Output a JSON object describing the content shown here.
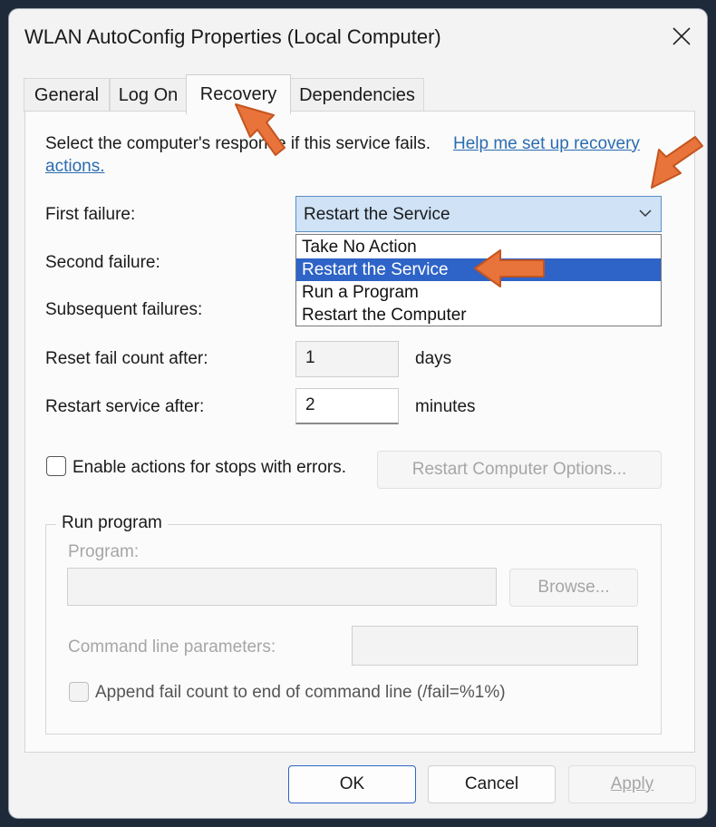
{
  "window": {
    "title": "WLAN AutoConfig Properties (Local Computer)"
  },
  "tabs": [
    {
      "label": "General"
    },
    {
      "label": "Log On"
    },
    {
      "label": "Recovery"
    },
    {
      "label": "Dependencies"
    }
  ],
  "active_tab": "Recovery",
  "recovery": {
    "intro_text": "Select the computer's response if this service fails.",
    "help_link": "Help me set up recovery",
    "help_link_2": "actions.",
    "first_failure_label": "First failure:",
    "first_failure_value": "Restart the Service",
    "second_failure_label": "Second failure:",
    "subsequent_failures_label": "Subsequent failures:",
    "dropdown_options": [
      "Take No Action",
      "Restart the Service",
      "Run a Program",
      "Restart the Computer"
    ],
    "selected_option": "Restart the Service",
    "reset_fail_count_label": "Reset fail count after:",
    "reset_fail_count_value": "1",
    "reset_fail_count_unit": "days",
    "restart_service_label": "Restart service after:",
    "restart_service_value": "2",
    "restart_service_unit": "minutes",
    "enable_actions_label": "Enable actions for stops with errors.",
    "restart_computer_options_label": "Restart Computer Options...",
    "run_program": {
      "group_title": "Run program",
      "program_label": "Program:",
      "browse_label": "Browse...",
      "cmd_params_label": "Command line parameters:",
      "append_label": "Append fail count to end of command line (/fail=%1%)"
    }
  },
  "footer": {
    "ok_label": "OK",
    "cancel_label": "Cancel",
    "apply_label": "Apply"
  },
  "colors": {
    "accent": "#2e63c7",
    "arrow": "#e8743b",
    "link": "#2b6cb0"
  }
}
